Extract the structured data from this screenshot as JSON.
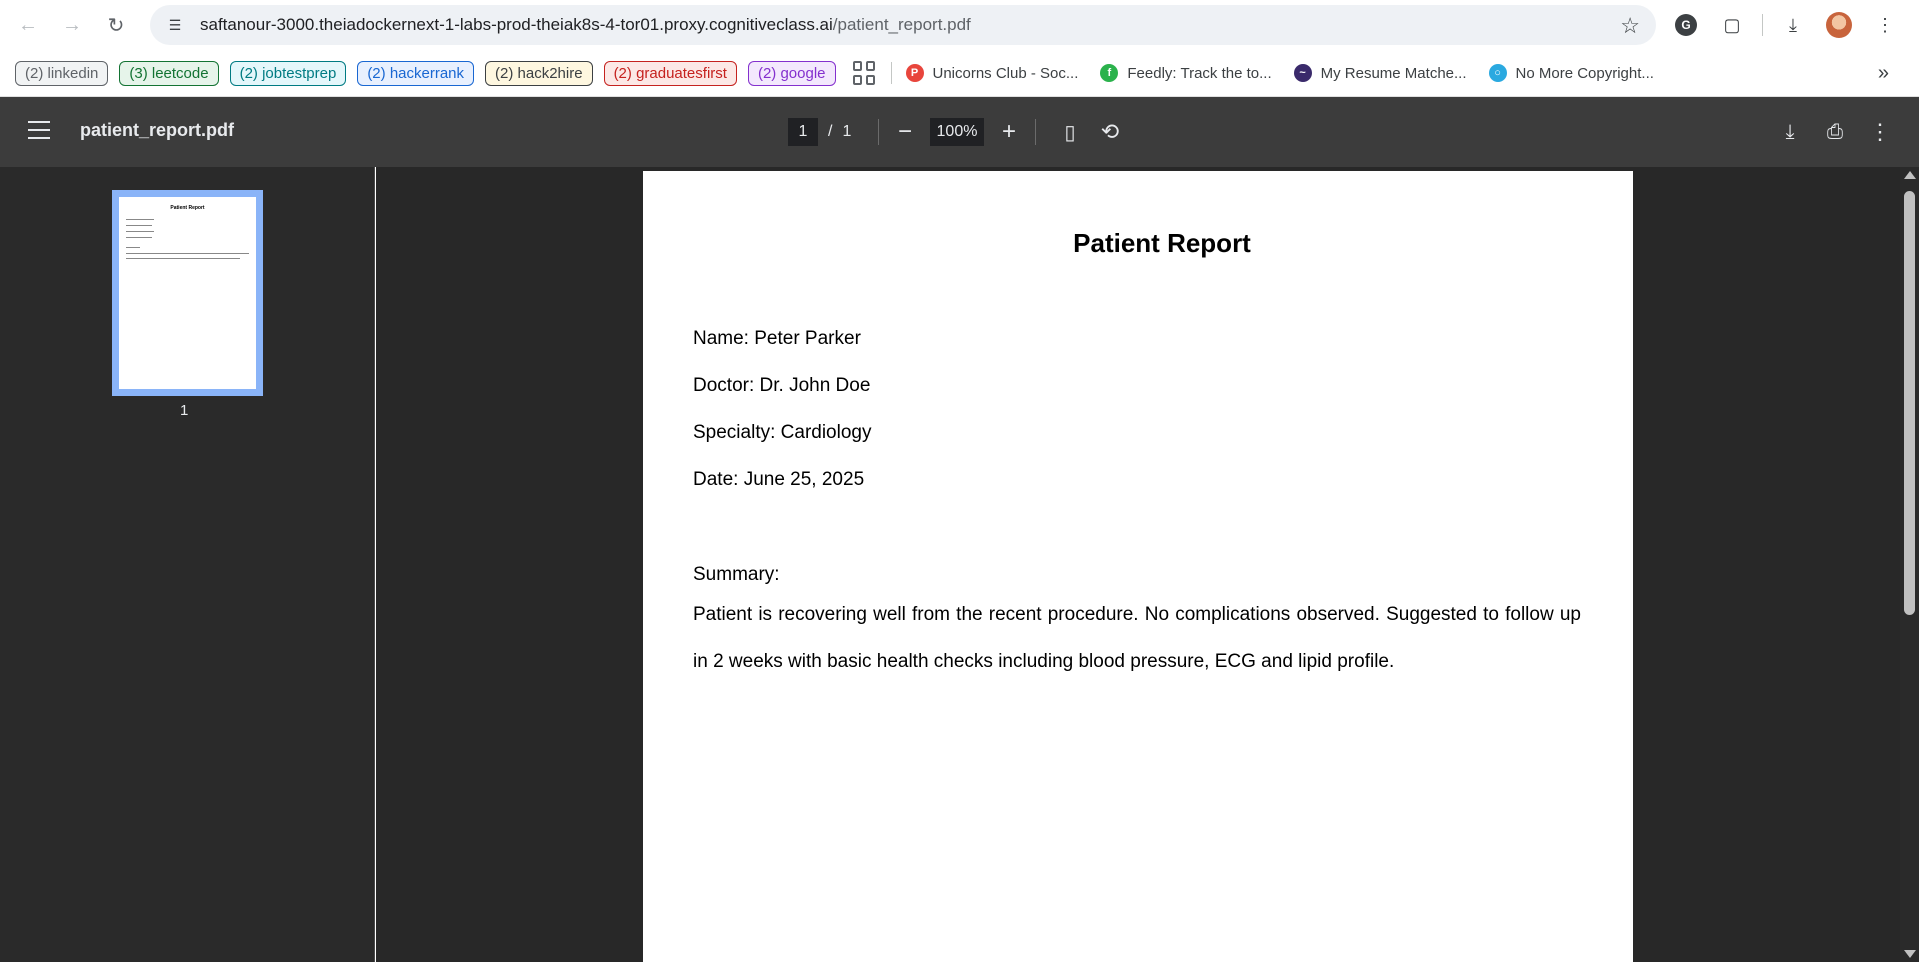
{
  "browser": {
    "url_host": "saftanour-3000.theiadockernext-1-labs-prod-theiak8s-4-tor01.proxy.cognitiveclass.ai",
    "url_path": "/patient_report.pdf",
    "site_info_icon": "tune-icon",
    "bookmark_star_icon": "star-icon"
  },
  "bookmark_chips": [
    {
      "label": "(2) linkedin",
      "color": "#5f6368",
      "bg": "#f1f3f4"
    },
    {
      "label": "(3) leetcode",
      "color": "#137333",
      "bg": "#e6f4ea"
    },
    {
      "label": "(2) jobtestprep",
      "color": "#007b83",
      "bg": "#e4f7fb"
    },
    {
      "label": "(2) hackerrank",
      "color": "#1967d2",
      "bg": "#e8f0fe"
    },
    {
      "label": "(2) hack2hire",
      "color": "#3c4043",
      "bg": "#fef7e0"
    },
    {
      "label": "(2) graduatesfirst",
      "color": "#c5221f",
      "bg": "#fce8e6"
    },
    {
      "label": "(2) google",
      "color": "#8430ce",
      "bg": "#f3e8fd"
    }
  ],
  "bookmarks": [
    {
      "label": "Unicorns Club - Soc...",
      "icon_color": "#e8453c",
      "glyph": "P"
    },
    {
      "label": "Feedly: Track the to...",
      "icon_color": "#2bb24c",
      "glyph": "f"
    },
    {
      "label": "My Resume Matche...",
      "icon_color": "#3a2a6b",
      "glyph": "~"
    },
    {
      "label": "No More Copyright...",
      "icon_color": "#2aa9e0",
      "glyph": "○"
    }
  ],
  "pdf": {
    "filename": "patient_report.pdf",
    "current_page": "1",
    "separator": "/",
    "total_pages": "1",
    "zoom": "100%",
    "thumbnail_label": "1"
  },
  "report": {
    "title": "Patient Report",
    "name": "Name: Peter Parker",
    "doctor": "Doctor: Dr. John Doe",
    "specialty": "Specialty: Cardiology",
    "date": "Date: June 25, 2025",
    "summary_heading": "Summary:",
    "summary_text": "Patient is recovering well from the recent procedure. No complications observed. Suggested to follow up in 2 weeks with basic health checks including blood pressure, ECG and lipid profile."
  }
}
